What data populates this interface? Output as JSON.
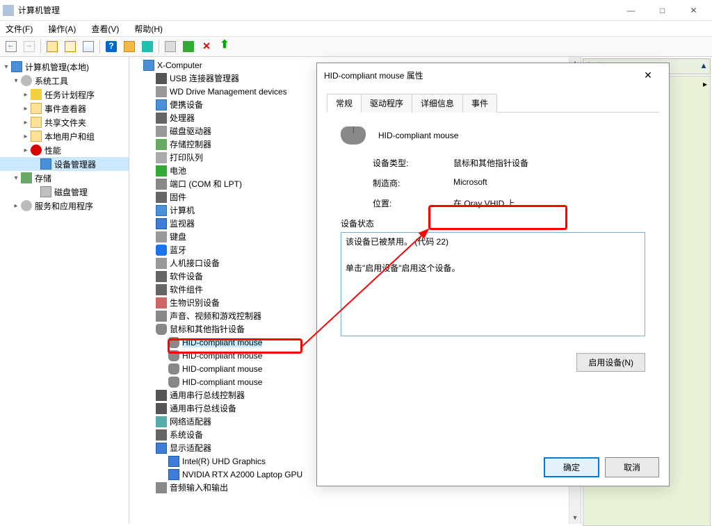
{
  "window": {
    "title": "计算机管理",
    "minimize": "—",
    "maximize": "□",
    "close": "✕"
  },
  "menu": {
    "file": "文件(F)",
    "action": "操作(A)",
    "view": "查看(V)",
    "help": "帮助(H)"
  },
  "left_tree": {
    "root": "计算机管理(本地)",
    "sys_tools": "系统工具",
    "task_sched": "任务计划程序",
    "event_viewer": "事件查看器",
    "shared": "共享文件夹",
    "local_users": "本地用户和组",
    "perf": "性能",
    "devmgr": "设备管理器",
    "storage": "存储",
    "diskmgmt": "磁盘管理",
    "services": "服务和应用程序"
  },
  "devtree": {
    "root": "X-Computer",
    "usb_conn": "USB 连接器管理器",
    "wd_drive": "WD Drive Management devices",
    "portable": "便携设备",
    "processors": "处理器",
    "disk_drives": "磁盘驱动器",
    "storage_ctrl": "存储控制器",
    "print_queue": "打印队列",
    "battery": "电池",
    "ports": "端口 (COM 和 LPT)",
    "firmware": "固件",
    "computer": "计算机",
    "monitors": "监视器",
    "keyboards": "键盘",
    "bluetooth": "蓝牙",
    "hid": "人机接口设备",
    "sw_devices": "软件设备",
    "sw_components": "软件组件",
    "biometric": "生物识别设备",
    "sound": "声音、视频和游戏控制器",
    "mice": "鼠标和其他指针设备",
    "mouse_hid": "HID-compliant mouse",
    "usb_ctrl": "通用串行总线控制器",
    "usb_devices": "通用串行总线设备",
    "network": "网络适配器",
    "system": "系统设备",
    "display": "显示适配器",
    "intel_gpu": "Intel(R) UHD Graphics",
    "nvidia_gpu": "NVIDIA RTX A2000 Laptop GPU",
    "audio_io": "音频输入和输出"
  },
  "right": {
    "header": "操作"
  },
  "dialog": {
    "title": "HID-compliant mouse 属性",
    "tabs": {
      "general": "常规",
      "driver": "驱动程序",
      "details": "详细信息",
      "events": "事件"
    },
    "device_name": "HID-compliant mouse",
    "type_label": "设备类型:",
    "type_value": "鼠标和其他指针设备",
    "mfr_label": "制造商:",
    "mfr_value": "Microsoft",
    "loc_label": "位置:",
    "loc_value": "在 Oray VHID 上",
    "status_label": "设备状态",
    "status_line1": "该设备已被禁用。 (代码 22)",
    "status_line2": "单击\"启用设备\"启用这个设备。",
    "enable_btn": "启用设备(N)",
    "ok": "确定",
    "cancel": "取消"
  }
}
